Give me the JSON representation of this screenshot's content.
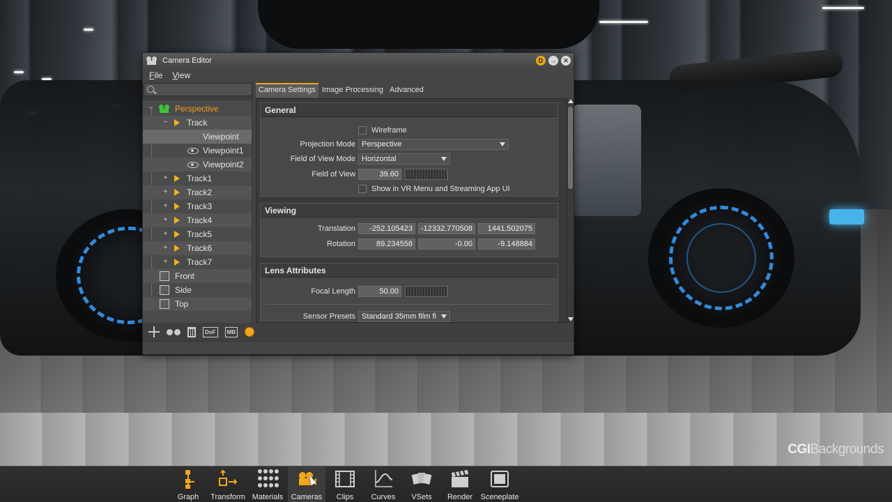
{
  "window": {
    "title": "Camera Editor",
    "menus": [
      "File",
      "View"
    ]
  },
  "tree": {
    "search_placeholder": "",
    "items": [
      {
        "label": "Perspective",
        "color": "#f29a1f",
        "icon": "perspective-camera-icon"
      },
      {
        "label": "Track",
        "icon": "track-icon"
      },
      {
        "label": "Viewpoint",
        "icon": "viewpoint-icon"
      },
      {
        "label": "Viewpoint1",
        "icon": "eye-icon"
      },
      {
        "label": "Viewpoint2",
        "icon": "eye-icon"
      },
      {
        "label": "Track1",
        "icon": "track-icon"
      },
      {
        "label": "Track2",
        "icon": "track-icon"
      },
      {
        "label": "Track3",
        "icon": "track-icon"
      },
      {
        "label": "Track4",
        "icon": "track-icon"
      },
      {
        "label": "Track5",
        "icon": "track-icon"
      },
      {
        "label": "Track6",
        "icon": "track-icon"
      },
      {
        "label": "Track7",
        "icon": "track-icon"
      },
      {
        "label": "Front",
        "icon": "cube-icon"
      },
      {
        "label": "Side",
        "icon": "cube-icon"
      },
      {
        "label": "Top",
        "icon": "cube-icon"
      }
    ]
  },
  "tabs": [
    "Camera Settings",
    "Image Processing",
    "Advanced"
  ],
  "general": {
    "title": "General",
    "wireframe_label": "Wireframe",
    "projection_mode_label": "Projection Mode",
    "projection_mode_value": "Perspective",
    "fov_mode_label": "Field of View Mode",
    "fov_mode_value": "Horizontal",
    "fov_label": "Field of View",
    "fov_value": "39.60",
    "vr_label": "Show in VR Menu and Streaming App UI"
  },
  "viewing": {
    "title": "Viewing",
    "translation_label": "Translation",
    "translation": [
      "-252.105423",
      "-12332.770508",
      "1441.502075"
    ],
    "rotation_label": "Rotation",
    "rotation": [
      "89.234558",
      "-0.00",
      "-9.148884"
    ]
  },
  "lens": {
    "title": "Lens Attributes",
    "focal_length_label": "Focal Length",
    "focal_length_value": "50.00",
    "sensor_presets_label": "Sensor Presets",
    "sensor_presets_value": "Standard 35mm film fi"
  },
  "bottom_toolbar": {
    "dof_label": "DoF",
    "mb_label": "MB"
  },
  "modules": [
    "Graph",
    "Transform",
    "Materials",
    "Cameras",
    "Clips",
    "Curves",
    "VSets",
    "Render",
    "Sceneplate"
  ],
  "active_module": "Cameras",
  "watermark": {
    "bold": "CGI",
    "thin": "Backgrounds"
  },
  "colors": {
    "accent": "#f2a81c",
    "selected_tree_text": "#f29a1f"
  }
}
